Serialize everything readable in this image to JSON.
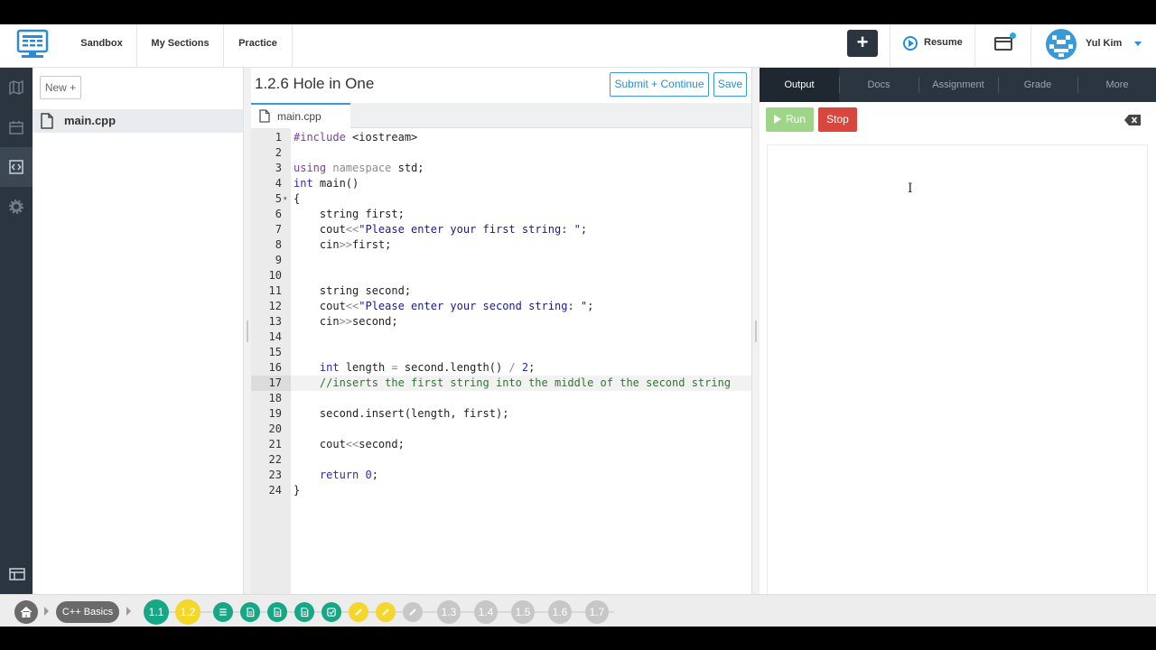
{
  "nav": {
    "links": [
      "Sandbox",
      "My Sections",
      "Practice"
    ],
    "plus": "+",
    "resume": "Resume",
    "user": "Yul Kim",
    "colors": {
      "accent": "#3a9ad9",
      "dark": "#2b3540"
    }
  },
  "files": {
    "new_button": "New +",
    "items": [
      "main.cpp"
    ]
  },
  "editor": {
    "title": "1.2.6 Hole in One",
    "submit": "Submit + Continue",
    "save": "Save",
    "tab": "main.cpp",
    "active_line": 17,
    "lines": [
      "#include <iostream>",
      "",
      "using namespace std;",
      "int main()",
      "{",
      "    string first;",
      "    cout<<\"Please enter your first string: \";",
      "    cin>>first;",
      "",
      "",
      "    string second;",
      "    cout<<\"Please enter your second string: \";",
      "    cin>>second;",
      "",
      "",
      "    int length = second.length() / 2;",
      "    //inserts the first string into the middle of the second string",
      "",
      "    second.insert(length, first);",
      "",
      "    cout<<second;",
      "",
      "    return 0;",
      "}"
    ]
  },
  "right": {
    "tabs": [
      "Output",
      "Docs",
      "Assignment",
      "Grade",
      "More"
    ],
    "run": "Run",
    "stop": "Stop"
  },
  "bottom": {
    "course": "C++ Basics",
    "nodes": [
      {
        "label": "1.1",
        "kind": "green"
      },
      {
        "label": "1.2",
        "kind": "yellow"
      },
      {
        "icon": "list-icon",
        "kind": "green"
      },
      {
        "icon": "doc-icon",
        "kind": "green"
      },
      {
        "icon": "doc-icon",
        "kind": "green"
      },
      {
        "icon": "doc-icon",
        "kind": "green"
      },
      {
        "icon": "check-icon",
        "kind": "green"
      },
      {
        "icon": "pencil-icon",
        "kind": "yellow"
      },
      {
        "icon": "pencil-icon",
        "kind": "yellow"
      },
      {
        "icon": "pencil-icon",
        "kind": "gray"
      },
      {
        "label": "1.3",
        "kind": "gray"
      },
      {
        "label": "1.4",
        "kind": "gray"
      },
      {
        "label": "1.5",
        "kind": "gray"
      },
      {
        "label": "1.6",
        "kind": "gray"
      },
      {
        "label": "1.7",
        "kind": "gray"
      }
    ]
  }
}
